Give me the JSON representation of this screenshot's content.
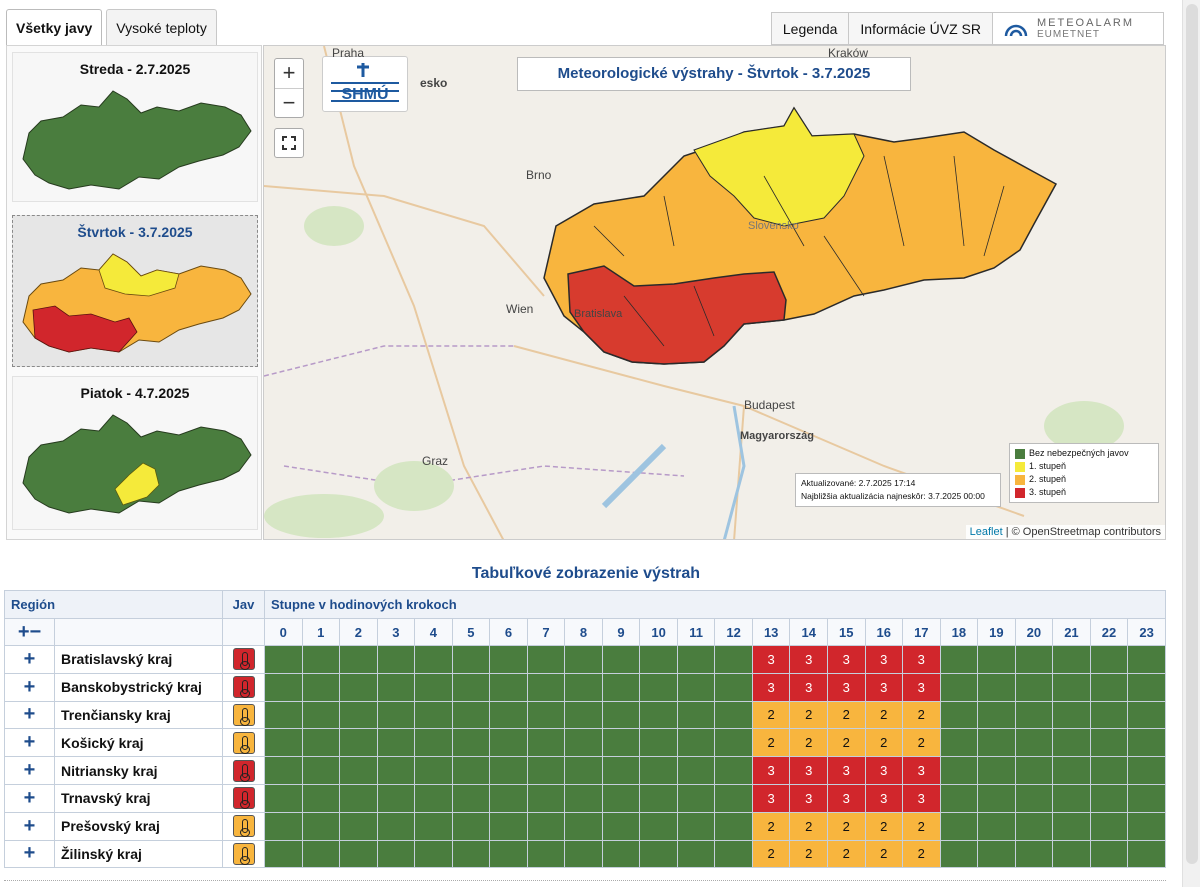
{
  "tabs": [
    {
      "label": "Všetky javy",
      "active": true
    },
    {
      "label": "Vysoké teploty",
      "active": false
    }
  ],
  "top_buttons": {
    "legend": "Legenda",
    "info": "Informácie ÚVZ SR",
    "meteoalarm_title": "METEOALARM",
    "meteoalarm_sub": "EUMETNET"
  },
  "days": [
    {
      "label": "Streda - 2.7.2025",
      "selected": false
    },
    {
      "label": "Štvrtok - 3.7.2025",
      "selected": true
    },
    {
      "label": "Piatok - 4.7.2025",
      "selected": false
    }
  ],
  "map": {
    "title": "Meteorologické výstrahy - Štvrtok - 3.7.2025",
    "zoom_in": "+",
    "zoom_out": "−",
    "logo_text": "SHMÚ",
    "cities": {
      "praha": "Praha",
      "brno": "Brno",
      "wien": "Wien",
      "budapest": "Budapest",
      "graz": "Graz",
      "krakow": "Kraków",
      "madarsko": "Magyarország",
      "slovensko": "Slovensko",
      "cesko": "esko",
      "bratislava": "Bratislava"
    },
    "update_line1": "Aktualizované: 2.7.2025 17:14",
    "update_line2": "Najbližšia aktualizácia najneskôr: 3.7.2025 00:00",
    "legend": [
      {
        "label": "Bez nebezpečných javov",
        "color": "#4a7d3e"
      },
      {
        "label": "1. stupeň",
        "color": "#f5ea3a"
      },
      {
        "label": "2. stupeň",
        "color": "#f8b53e"
      },
      {
        "label": "3. stupeň",
        "color": "#d1262c"
      }
    ],
    "attribution_leaflet": "Leaflet",
    "attribution_rest": " | © OpenStreetmap contributors"
  },
  "table": {
    "title": "Tabuľkové zobrazenie výstrah",
    "header_region": "Región",
    "header_jav": "Jav",
    "header_steps": "Stupne v hodinových krokoch",
    "expand_collapse": "+−",
    "hours": [
      "0",
      "1",
      "2",
      "3",
      "4",
      "5",
      "6",
      "7",
      "8",
      "9",
      "10",
      "11",
      "12",
      "13",
      "14",
      "15",
      "16",
      "17",
      "18",
      "19",
      "20",
      "21",
      "22",
      "23"
    ],
    "rows": [
      {
        "region": "Bratislavský kraj",
        "level": 3
      },
      {
        "region": "Banskobystrický kraj",
        "level": 3
      },
      {
        "region": "Trenčiansky kraj",
        "level": 2
      },
      {
        "region": "Košický kraj",
        "level": 2
      },
      {
        "region": "Nitriansky kraj",
        "level": 3
      },
      {
        "region": "Trnavský kraj",
        "level": 3
      },
      {
        "region": "Prešovský kraj",
        "level": 2
      },
      {
        "region": "Žilinský kraj",
        "level": 2
      }
    ],
    "warning_hours": [
      13,
      14,
      15,
      16,
      17
    ],
    "row_expand": "+"
  },
  "colors": {
    "green": "#4a7d3e",
    "yellow": "#f5ea3a",
    "orange": "#f8b53e",
    "red": "#d1262c",
    "title_blue": "#1e4c8c"
  }
}
